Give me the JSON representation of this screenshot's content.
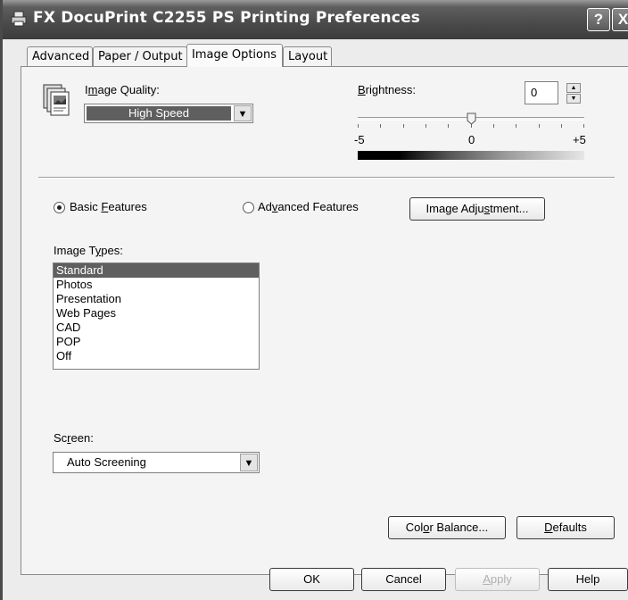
{
  "window": {
    "title": "FX DocuPrint C2255 PS Printing Preferences",
    "help_glyph": "?",
    "close_glyph": "X"
  },
  "tabs": [
    {
      "label": "Advanced"
    },
    {
      "label": "Paper / Output"
    },
    {
      "label": "Image Options"
    },
    {
      "label": "Layout"
    }
  ],
  "image_quality": {
    "label_prefix": "I",
    "label_accel": "m",
    "label_suffix": "age Quality:",
    "value": "High Speed"
  },
  "brightness": {
    "label_accel": "B",
    "label_suffix": "rightness:",
    "value": "0",
    "min_label": "-5",
    "mid_label": "0",
    "max_label": "+5",
    "slider_level": 0
  },
  "features": {
    "basic_prefix": "Basic ",
    "basic_accel": "F",
    "basic_suffix": "eatures",
    "advanced_prefix": "Ad",
    "advanced_accel": "v",
    "advanced_suffix": "anced Features",
    "selected": "basic"
  },
  "image_adjustment_button": {
    "prefix": "Image Adju",
    "accel": "s",
    "suffix": "tment..."
  },
  "image_types": {
    "label_prefix": "Image T",
    "label_accel": "y",
    "label_suffix": "pes:",
    "items": [
      "Standard",
      "Photos",
      "Presentation",
      "Web Pages",
      "CAD",
      "POP",
      "Off"
    ],
    "selected_index": 0
  },
  "screen": {
    "label_prefix": "Sc",
    "label_accel": "r",
    "label_suffix": "een:",
    "value": "Auto Screening"
  },
  "color_balance_button": {
    "prefix": "Col",
    "accel": "o",
    "suffix": "r Balance..."
  },
  "defaults_button": {
    "accel": "D",
    "suffix": "efaults"
  },
  "footer": {
    "ok": "OK",
    "cancel": "Cancel",
    "apply_accel": "A",
    "apply_suffix": "pply",
    "help": "Help"
  }
}
